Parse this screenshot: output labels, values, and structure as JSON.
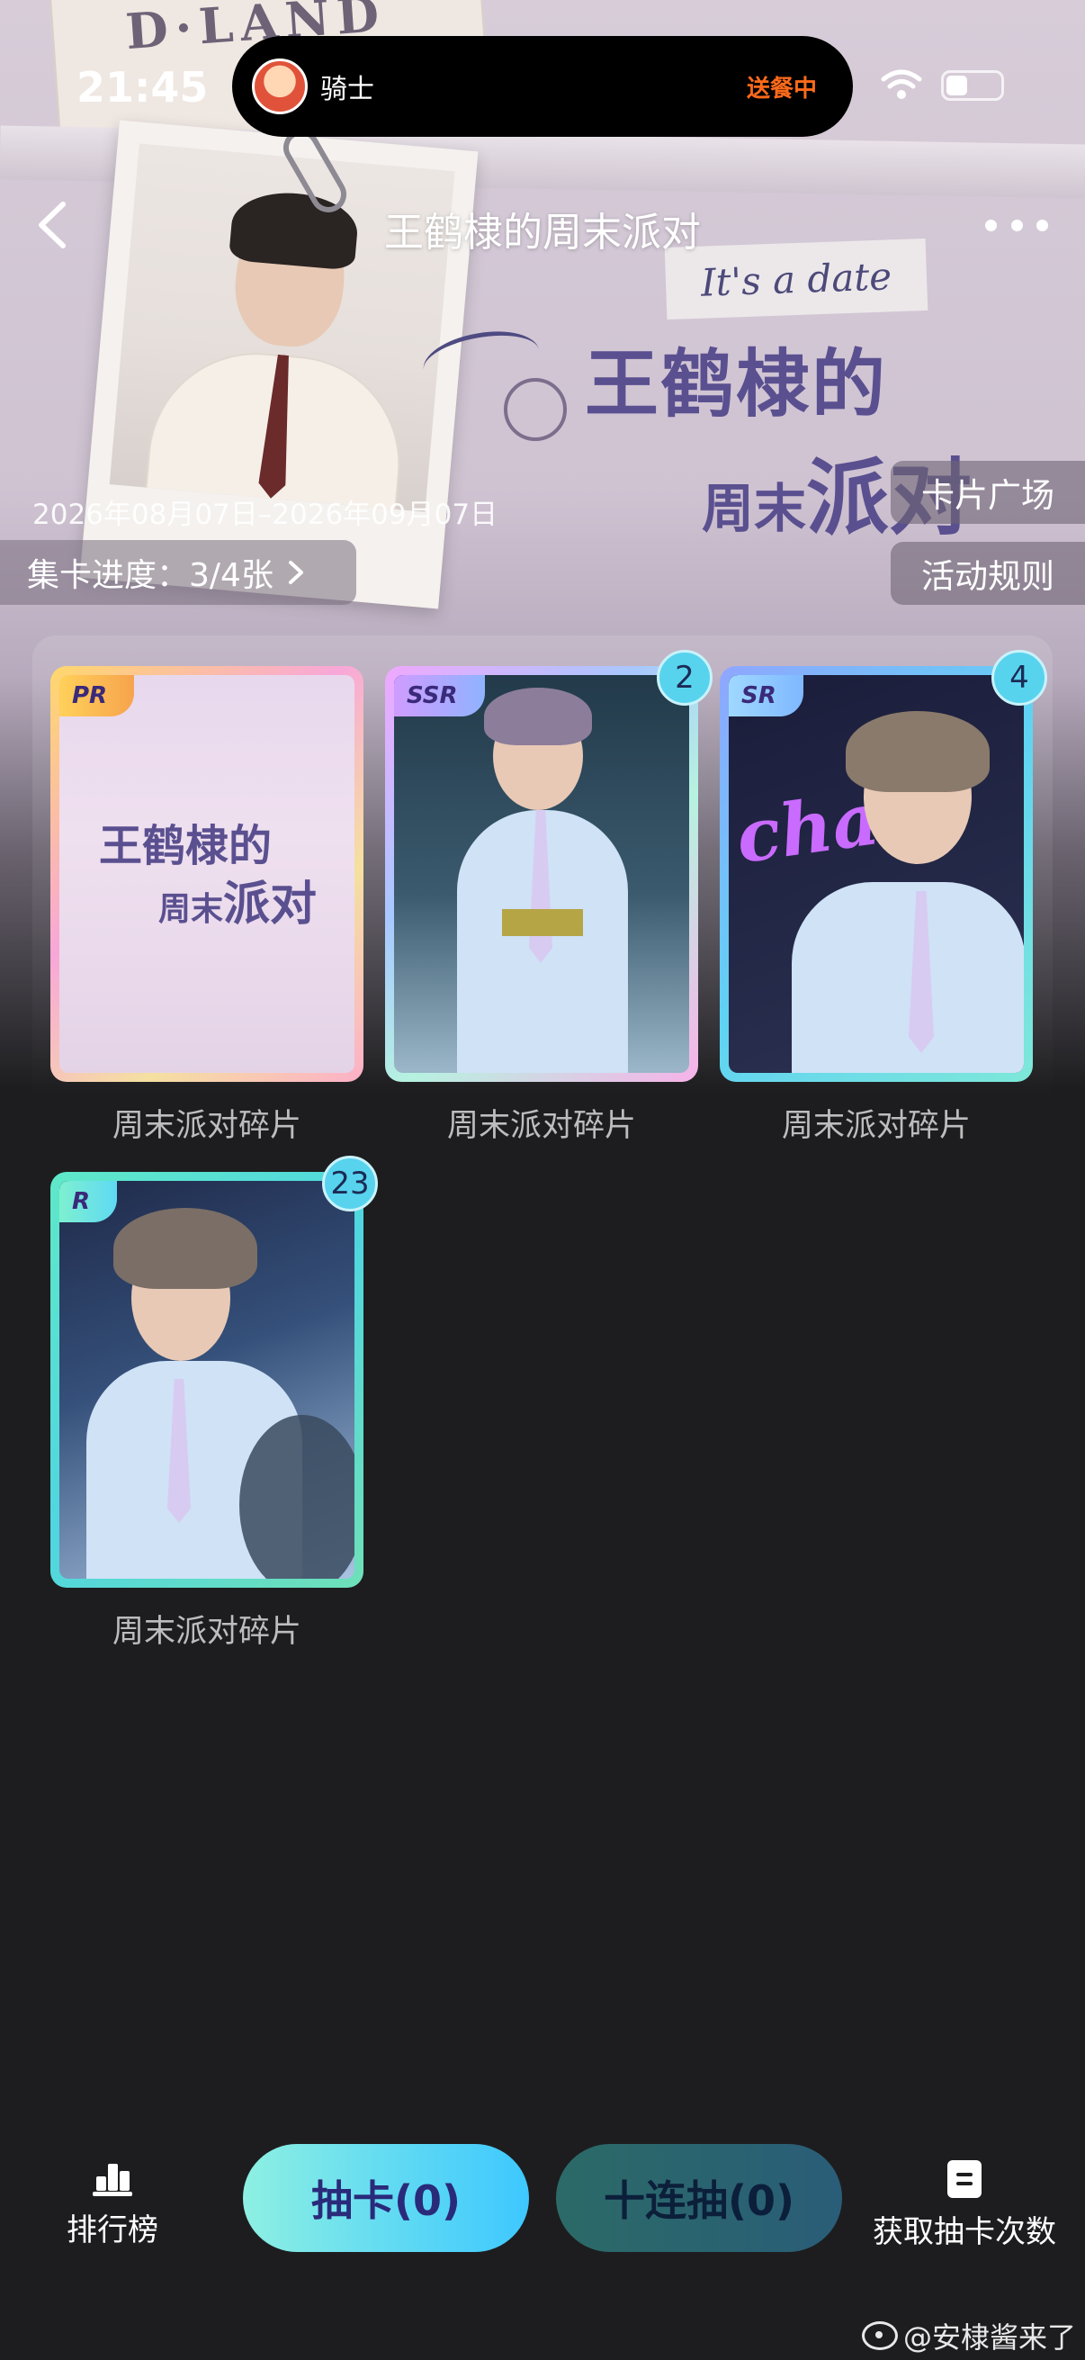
{
  "status_bar": {
    "time": "21:45",
    "live_activity": {
      "label": "骑士",
      "status": "送餐中"
    },
    "wifi_icon": "wifi-icon",
    "battery_icon": "battery-icon"
  },
  "header": {
    "title": "王鹤棣的周末派对",
    "back_icon": "chevron-left-icon",
    "more_icon": "more-dots-icon"
  },
  "banner": {
    "tagline": "It's a date",
    "art_title_line1": "王鹤棣的",
    "art_title_line2_a": "周末",
    "art_title_line2_b": "派对",
    "paper_text": "D·LAND"
  },
  "event": {
    "date_range": "2026年08月07日–2026年09月07日",
    "progress_label": "集卡进度：3/4张",
    "progress": {
      "collected": 3,
      "total": 4
    }
  },
  "side_buttons": {
    "card_plaza": "卡片广场",
    "rules": "活动规则"
  },
  "cards": [
    {
      "rarity": "PR",
      "name": "周末派对碎片",
      "count": "",
      "art_line1": "王鹤棣的",
      "art_line2a": "周末",
      "art_line2b": "派对"
    },
    {
      "rarity": "SSR",
      "name": "周末派对碎片",
      "count": "2"
    },
    {
      "rarity": "SR",
      "name": "周末派对碎片",
      "count": "4",
      "art_text": "chat"
    },
    {
      "rarity": "R",
      "name": "周末派对碎片",
      "count": "23"
    }
  ],
  "bottom_bar": {
    "ranking": {
      "label": "排行榜",
      "icon": "ranking-icon"
    },
    "draw": "抽卡(0)",
    "ten_draw": "十连抽(0)",
    "get_draws": {
      "label": "获取抽卡次数",
      "icon": "document-icon"
    }
  },
  "watermark": "@安棣酱来了",
  "colors": {
    "background": "#1d1d1f",
    "accent_cyan": "#5fd9f3",
    "delivery_orange": "#ff6a1a",
    "badge": "#58d3ee"
  }
}
